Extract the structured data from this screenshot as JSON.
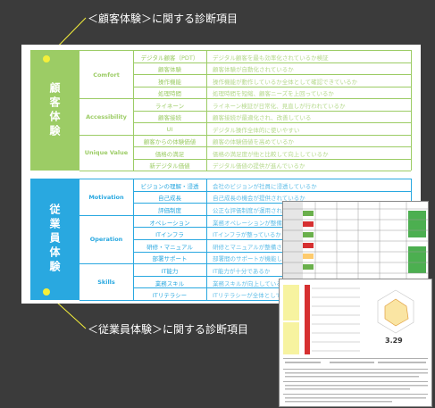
{
  "captions": {
    "top": "＜顧客体験＞に関する診断項目",
    "bottom": "＜従業員体験＞に関する診断項目"
  },
  "customer": {
    "band_label": "顧客体験",
    "color": "#9ccc65",
    "rows": [
      {
        "cat": "Comfort",
        "item": "デジタル顧客（PDT）",
        "desc": "デジタル顧客を最も効率化されているか検証"
      },
      {
        "cat": "",
        "item": "顧客体験",
        "desc": "顧客体験が自動化されているか"
      },
      {
        "cat": "",
        "item": "操作機能",
        "desc": "操作機能が動作しているか全体として確認できているか"
      },
      {
        "cat": "",
        "item": "処理時間",
        "desc": "処理時間を短縮、顧客ニーズを上回っているか"
      },
      {
        "cat": "Accessibility",
        "item": "ライネーン",
        "desc": "ライネーン検証が日常化、見直しが行われているか"
      },
      {
        "cat": "",
        "item": "顧客接続",
        "desc": "顧客接続が最適化され、改善している"
      },
      {
        "cat": "",
        "item": "UI",
        "desc": "デジタル操作全体的に使いやすい"
      },
      {
        "cat": "Unique Value",
        "item": "顧客からの体験価値",
        "desc": "顧客の体験価値を高めているか"
      },
      {
        "cat": "",
        "item": "価格の満足",
        "desc": "価格の満足度が他と比較して向上しているか"
      },
      {
        "cat": "",
        "item": "新デジタル価値",
        "desc": "デジタル価値の提供が進んでいるか"
      }
    ]
  },
  "employee": {
    "band_label": "従業員体験",
    "color": "#29a8e0",
    "rows": [
      {
        "cat": "Motivation",
        "item": "ビジョンの理解・浸透",
        "desc": "会社のビジョンが社員に浸透しているか"
      },
      {
        "cat": "",
        "item": "自己成長",
        "desc": "自己成長の機会が提供されているか"
      },
      {
        "cat": "",
        "item": "評価制度",
        "desc": "公正な評価制度が運用されているか"
      },
      {
        "cat": "Operation",
        "item": "オペレーション",
        "desc": "業務オペレーションが整備されているか"
      },
      {
        "cat": "",
        "item": "ITインフラ",
        "desc": "ITインフラが整っているか"
      },
      {
        "cat": "",
        "item": "研修・マニュアル",
        "desc": "研修とマニュアルが整備されているか"
      },
      {
        "cat": "",
        "item": "部署サポート",
        "desc": "部署間のサポートが機能しているか"
      },
      {
        "cat": "Skills",
        "item": "IT能力",
        "desc": "IT能力が十分であるか"
      },
      {
        "cat": "",
        "item": "業務スキル",
        "desc": "業務スキルが向上しているか"
      },
      {
        "cat": "",
        "item": "ITリテラシー",
        "desc": "ITリテラシーが全体として高いか"
      }
    ]
  },
  "report": {
    "score": "3.29"
  }
}
